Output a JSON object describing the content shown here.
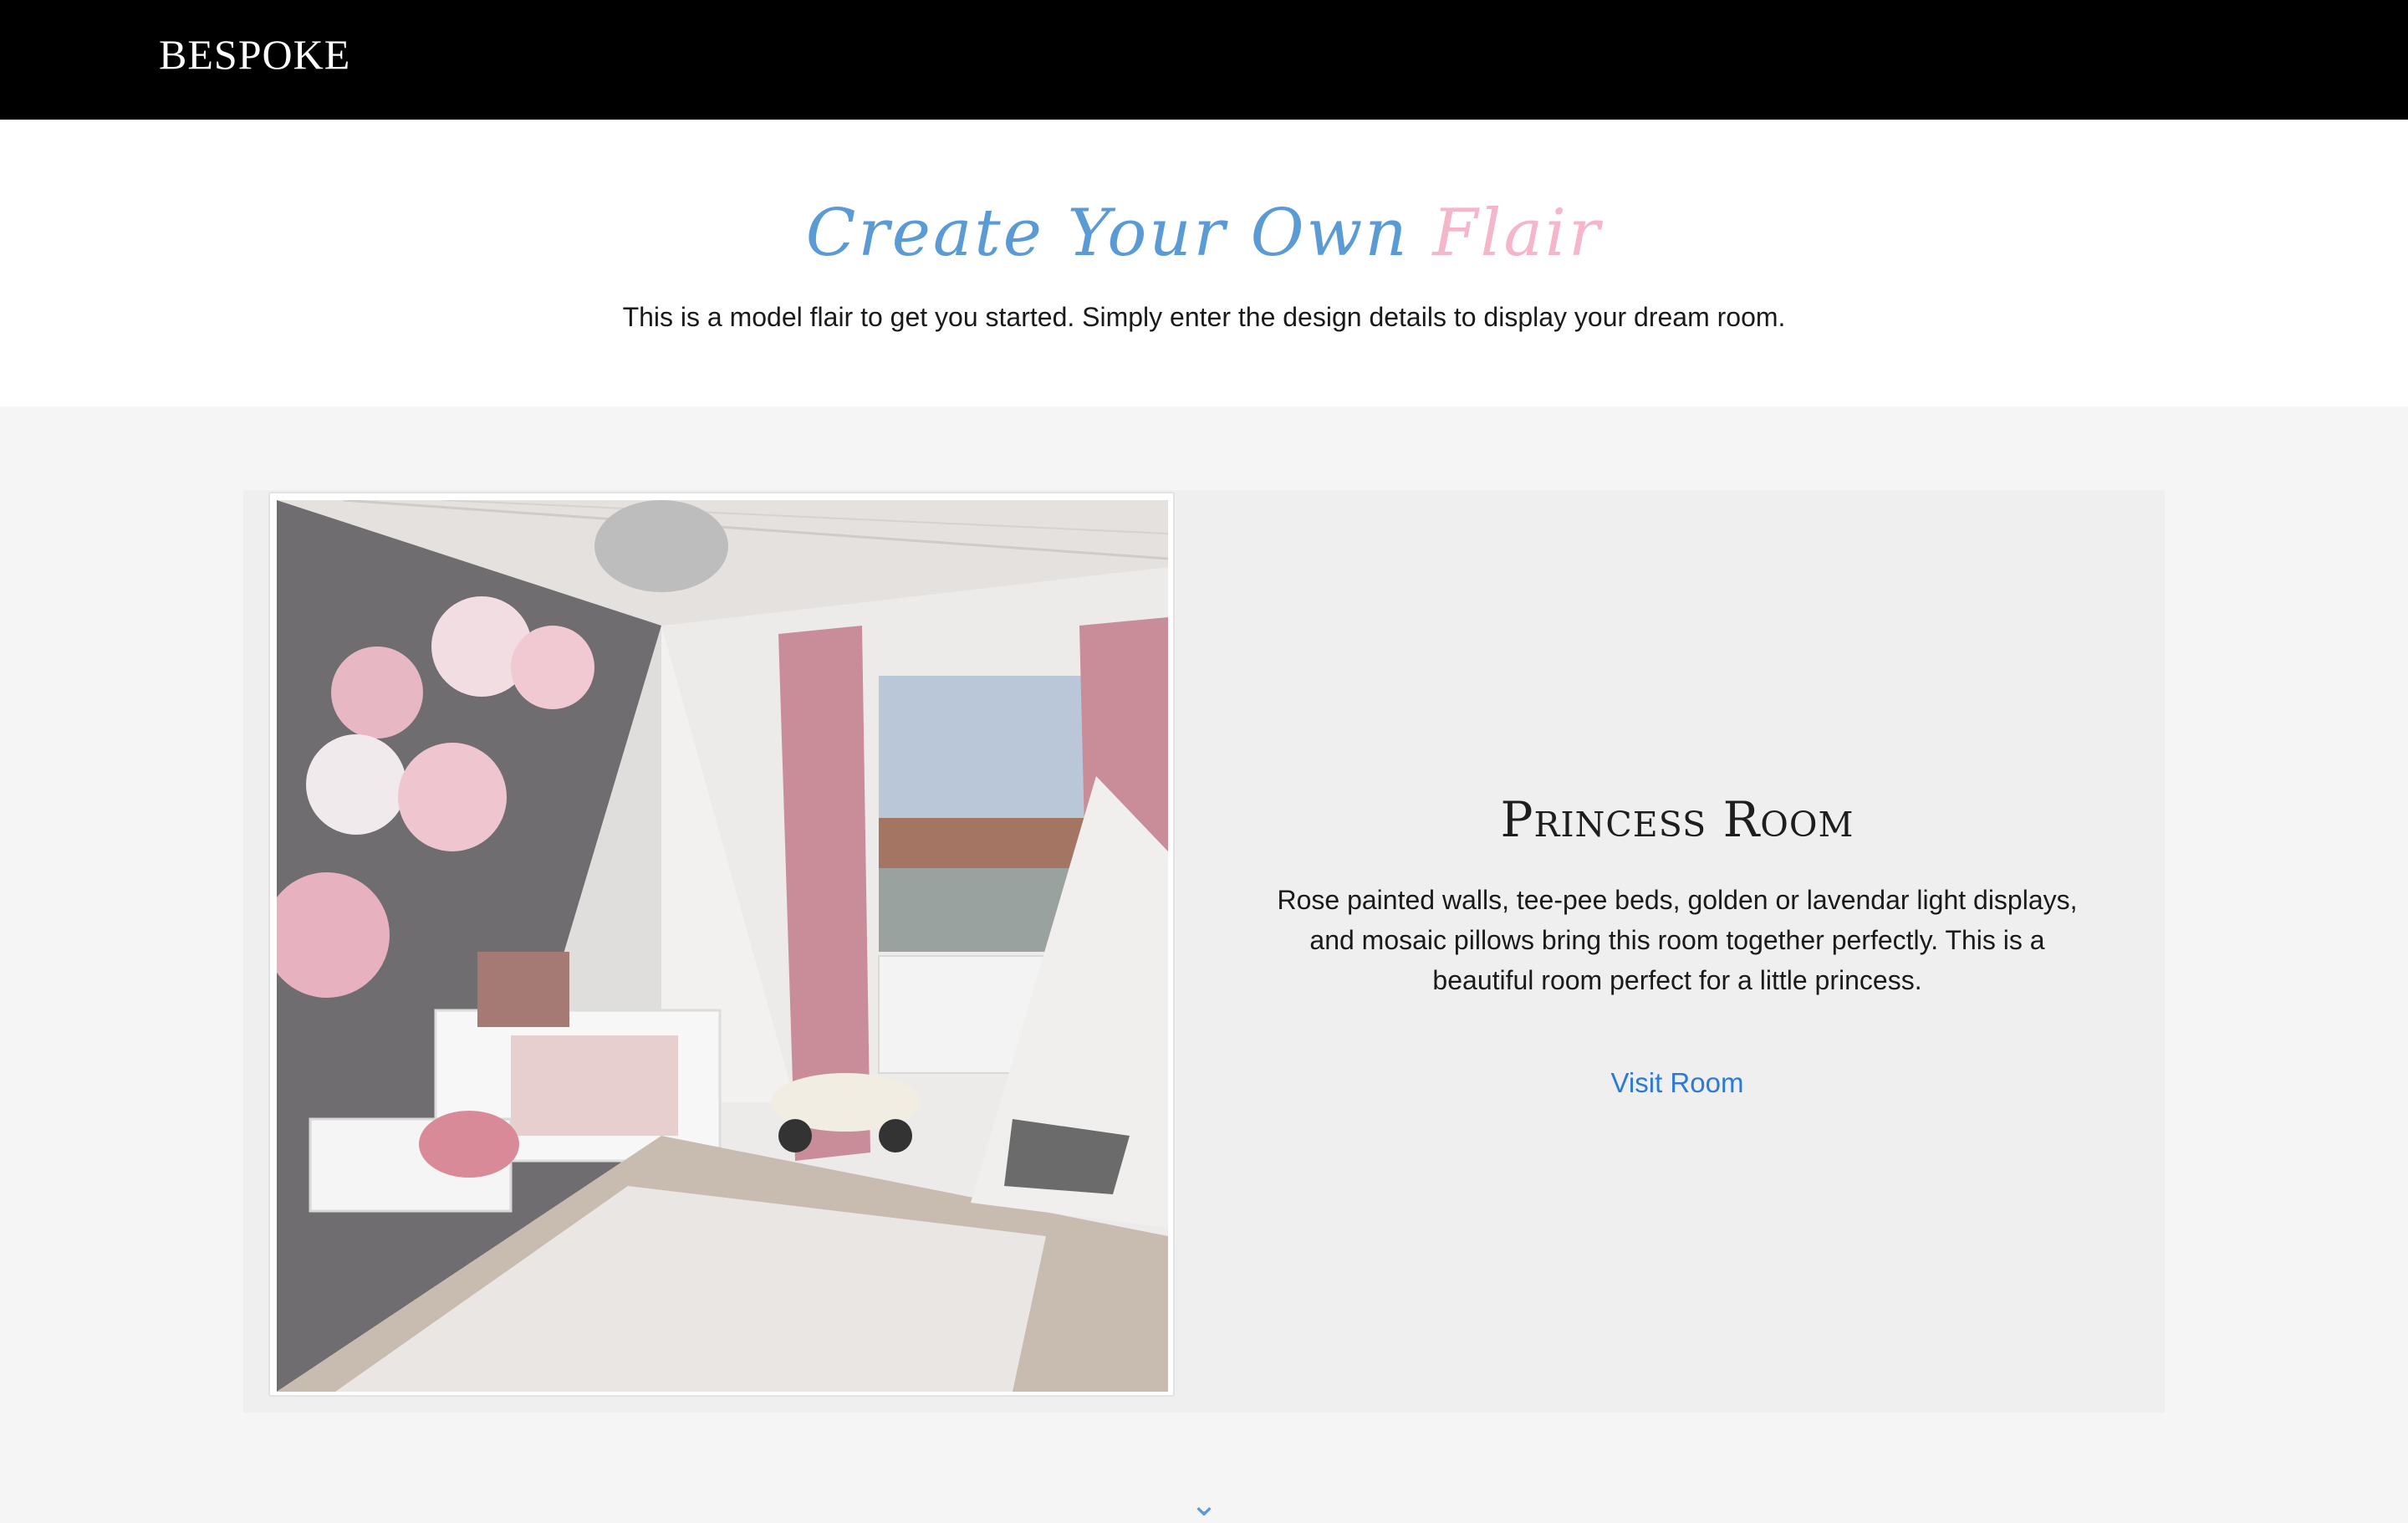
{
  "navbar": {
    "brand": "BESPOKE"
  },
  "intro": {
    "title_main": "Create Your Own",
    "title_accent": "Flair",
    "subtitle": "This is a model flair to get you started. Simply enter the design details to display your dream room."
  },
  "card": {
    "image_alt": "Princess room with pink peony wall decals, canopy bed, pink curtains and white tee-pee",
    "title": "Princess Room",
    "description": "Rose painted walls, tee-pee beds, golden or lavendar light displays, and mosaic pillows bring this room together perfectly. This is a beautiful room perfect for a little princess.",
    "link_label": "Visit Room"
  },
  "colors": {
    "navbar_bg": "#000000",
    "title_blue": "#5b9bd5",
    "title_pink": "#f4b6c8",
    "link_blue": "#2a7ad6",
    "page_bg": "#f5f5f5",
    "card_bg": "#efefef"
  }
}
